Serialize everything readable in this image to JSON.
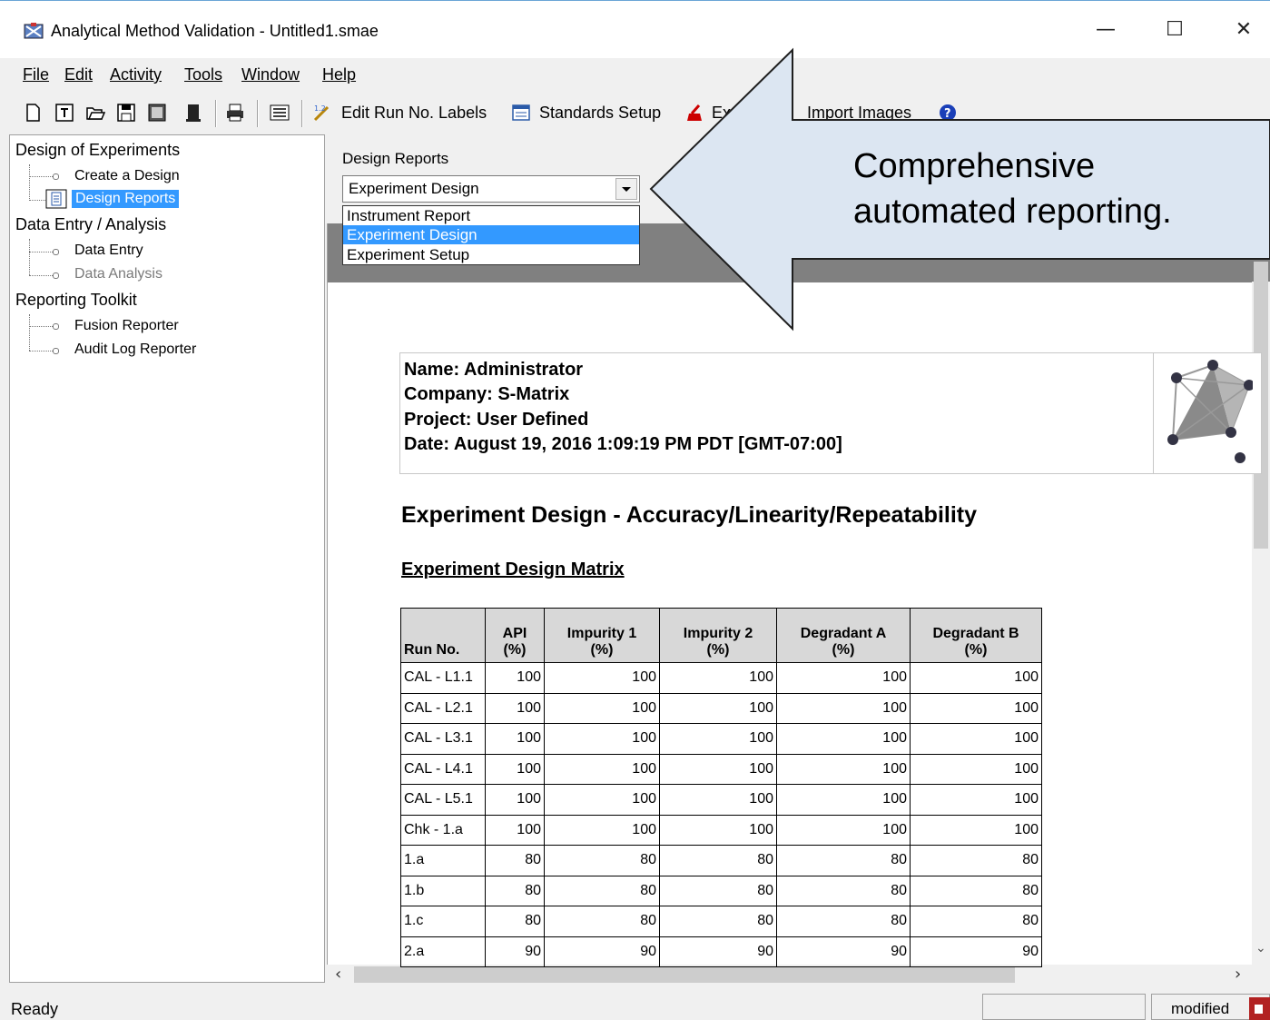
{
  "window": {
    "title": "Analytical Method Validation - Untitled1.smae",
    "minimize_glyph": "—",
    "maximize_glyph": "☐",
    "close_glyph": "✕"
  },
  "menu": [
    {
      "label": "File"
    },
    {
      "label": "Edit"
    },
    {
      "label": "Activity"
    },
    {
      "label": "Tools"
    },
    {
      "label": "Window"
    },
    {
      "label": "Help"
    }
  ],
  "toolbar": {
    "edit_run_labels": "Edit Run No. Labels",
    "standards_setup": "Standards Setup",
    "export_partial": "Ex",
    "import_images": "Import Images"
  },
  "tree": {
    "design_of_experiments": "Design of Experiments",
    "create_design": "Create a Design",
    "design_reports": "Design Reports",
    "data_entry_analysis": "Data Entry / Analysis",
    "data_entry": "Data Entry",
    "data_analysis": "Data Analysis",
    "reporting_toolkit": "Reporting Toolkit",
    "fusion_reporter": "Fusion Reporter",
    "audit_log_reporter": "Audit Log Reporter"
  },
  "design_reports": {
    "label": "Design Reports",
    "selected": "Experiment Design",
    "options": [
      "Instrument Report",
      "Experiment Design",
      "Experiment Setup"
    ]
  },
  "report": {
    "name": "Name: Administrator",
    "company": "Company: S-Matrix",
    "project": "Project: User Defined",
    "date": "Date: August 19, 2016 1:09:19 PM PDT [GMT-07:00]",
    "title": "Experiment Design - Accuracy/Linearity/Repeatability",
    "subtitle": "Experiment Design Matrix",
    "table": {
      "headers": [
        {
          "line1": "",
          "line2": "Run No."
        },
        {
          "line1": "API",
          "line2": "(%)"
        },
        {
          "line1": "Impurity 1",
          "line2": "(%)"
        },
        {
          "line1": "Impurity 2",
          "line2": "(%)"
        },
        {
          "line1": "Degradant A",
          "line2": "(%)"
        },
        {
          "line1": "Degradant B",
          "line2": "(%)"
        }
      ],
      "rows": [
        [
          "CAL - L1.1",
          "100",
          "100",
          "100",
          "100",
          "100"
        ],
        [
          "CAL - L2.1",
          "100",
          "100",
          "100",
          "100",
          "100"
        ],
        [
          "CAL - L3.1",
          "100",
          "100",
          "100",
          "100",
          "100"
        ],
        [
          "CAL - L4.1",
          "100",
          "100",
          "100",
          "100",
          "100"
        ],
        [
          "CAL - L5.1",
          "100",
          "100",
          "100",
          "100",
          "100"
        ],
        [
          "Chk - 1.a",
          "100",
          "100",
          "100",
          "100",
          "100"
        ],
        [
          "1.a",
          "80",
          "80",
          "80",
          "80",
          "80"
        ],
        [
          "1.b",
          "80",
          "80",
          "80",
          "80",
          "80"
        ],
        [
          "1.c",
          "80",
          "80",
          "80",
          "80",
          "80"
        ],
        [
          "2.a",
          "90",
          "90",
          "90",
          "90",
          "90"
        ]
      ]
    }
  },
  "callout": {
    "line1": "Comprehensive",
    "line2": "automated reporting."
  },
  "status": {
    "ready": "Ready",
    "modified": "modified"
  },
  "colors": {
    "selection": "#3399ff",
    "callout_fill": "#dce6f2",
    "callout_stroke": "#1f1f1f"
  }
}
